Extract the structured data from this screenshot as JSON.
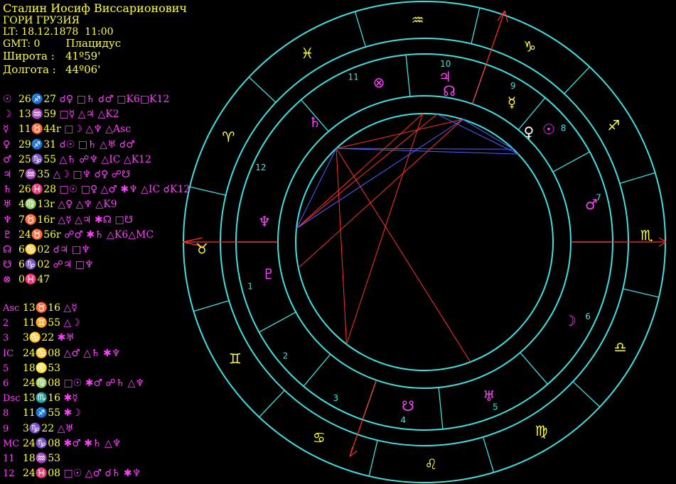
{
  "header": {
    "name": "Сталин Иосиф Виссарионович",
    "place": "ГОРИ ГРУЗИЯ",
    "lt": "LT: 18.12.1878  11:00",
    "gmt": "GMT: 0",
    "system": "Плацидус",
    "lat_label": "Широта :",
    "lat_value": "41º59'",
    "lon_label": "Долгота :",
    "lon_value": "44º06'"
  },
  "planets": [
    {
      "symbol": "☉",
      "position": "26♐27",
      "aspects": "☌♀ □♄ ☌♂ □K6□K12"
    },
    {
      "symbol": "☽",
      "position": "13♒59",
      "aspects": "□☿ △♃ △K2"
    },
    {
      "symbol": "☿",
      "position": "11♉44r",
      "aspects": "□☽ △♆ △Asc"
    },
    {
      "symbol": "♀",
      "position": "29♐31",
      "aspects": "☌☉ □♄ △♅ ☌♂"
    },
    {
      "symbol": "♂",
      "position": "25♑55",
      "aspects": "△♄ ☍♆ △IC △K12"
    },
    {
      "symbol": "♃",
      "position": "7♒35",
      "aspects": "△☽ □♆ ☌♀ ☍☋"
    },
    {
      "symbol": "♄",
      "position": "26♓28",
      "aspects": "□☉ □♀ △♂ ✱♆ △IC ☌K12"
    },
    {
      "symbol": "♅",
      "position": "4♍13r",
      "aspects": "△♀ △♆ △K9"
    },
    {
      "symbol": "♆",
      "position": "7♉16r",
      "aspects": "△☿ △♃ ✱☊ □☋"
    },
    {
      "symbol": "♇",
      "position": "24♉56r",
      "aspects": "☍♂ ✱♄ △K6△MC"
    },
    {
      "symbol": "☊",
      "position": "6♋02",
      "aspects": "☌♃ □♆"
    },
    {
      "symbol": "☋",
      "position": "6♑02",
      "aspects": "☍♃ □♆"
    },
    {
      "symbol": "⊗",
      "position": "0♓47",
      "aspects": ""
    }
  ],
  "houses": [
    {
      "label": "Asc",
      "position": "13♉16",
      "aspects": "△☿"
    },
    {
      "label": "2",
      "position": "11♊55",
      "aspects": "△☽"
    },
    {
      "label": "3",
      "position": "3♋22",
      "aspects": "✱♅"
    },
    {
      "label": "IC",
      "position": "24♋08",
      "aspects": "△♂ △♄ ✱♆"
    },
    {
      "label": "5",
      "position": "18♌53",
      "aspects": ""
    },
    {
      "label": "6",
      "position": "24♍08",
      "aspects": "□☉ ✱♂ ☍♄ △♆"
    },
    {
      "label": "Dsc",
      "position": "13♏16",
      "aspects": "✱☿"
    },
    {
      "label": "8",
      "position": "11♐55",
      "aspects": "✱☽"
    },
    {
      "label": "9",
      "position": "3♑22",
      "aspects": "△♅"
    },
    {
      "label": "MC",
      "position": "24♑08",
      "aspects": "✱♂ ✱♄ △♆"
    },
    {
      "label": "11",
      "position": "18♒53",
      "aspects": ""
    },
    {
      "label": "12",
      "position": "24♓08",
      "aspects": "□☉ △♂ ☌♄ ✱♆"
    }
  ],
  "wheel": {
    "ring_color": "#40e0e0",
    "axis_color": "#ff3030",
    "trine_color": "#ff3030",
    "sextile_color": "#5060ff",
    "sign_color": "#ffff40",
    "signs": [
      {
        "glyph": "♉",
        "name": "taurus"
      },
      {
        "glyph": "♊",
        "name": "gemini"
      },
      {
        "glyph": "♋",
        "name": "cancer"
      },
      {
        "glyph": "♌",
        "name": "leo"
      },
      {
        "glyph": "♍",
        "name": "virgo"
      },
      {
        "glyph": "♎",
        "name": "libra"
      },
      {
        "glyph": "♏",
        "name": "scorpio"
      },
      {
        "glyph": "♐",
        "name": "sagittarius"
      },
      {
        "glyph": "♑",
        "name": "capricorn"
      },
      {
        "glyph": "♒",
        "name": "aquarius"
      },
      {
        "glyph": "♓",
        "name": "pisces"
      },
      {
        "glyph": "♈",
        "name": "aries"
      }
    ],
    "house_numbers": [
      "1",
      "2",
      "3",
      "4",
      "5",
      "6",
      "7",
      "8",
      "9",
      "10",
      "11",
      "12"
    ],
    "planets": [
      {
        "glyph": "☉",
        "name": "sun",
        "color": "#ff40ff"
      },
      {
        "glyph": "♀",
        "name": "venus",
        "color": "#ffffff"
      },
      {
        "glyph": "☿",
        "name": "mercury",
        "color": "#ffff40"
      },
      {
        "glyph": "♂",
        "name": "mars",
        "color": "#ff40ff"
      },
      {
        "glyph": "☽",
        "name": "moon",
        "color": "#ff40ff"
      },
      {
        "glyph": "♃",
        "name": "jupiter",
        "color": "#ff40ff"
      },
      {
        "glyph": "☊",
        "name": "north-node",
        "color": "#ff40ff"
      },
      {
        "glyph": "♄",
        "name": "saturn",
        "color": "#ff40ff"
      },
      {
        "glyph": "⊗",
        "name": "part-of-fortune",
        "color": "#ff40ff"
      },
      {
        "glyph": "♅",
        "name": "uranus",
        "color": "#ff40ff"
      },
      {
        "glyph": "☋",
        "name": "south-node",
        "color": "#ff40ff"
      },
      {
        "glyph": "♆",
        "name": "neptune",
        "color": "#ff40ff"
      },
      {
        "glyph": "♇",
        "name": "pluto",
        "color": "#ff40ff"
      }
    ]
  }
}
